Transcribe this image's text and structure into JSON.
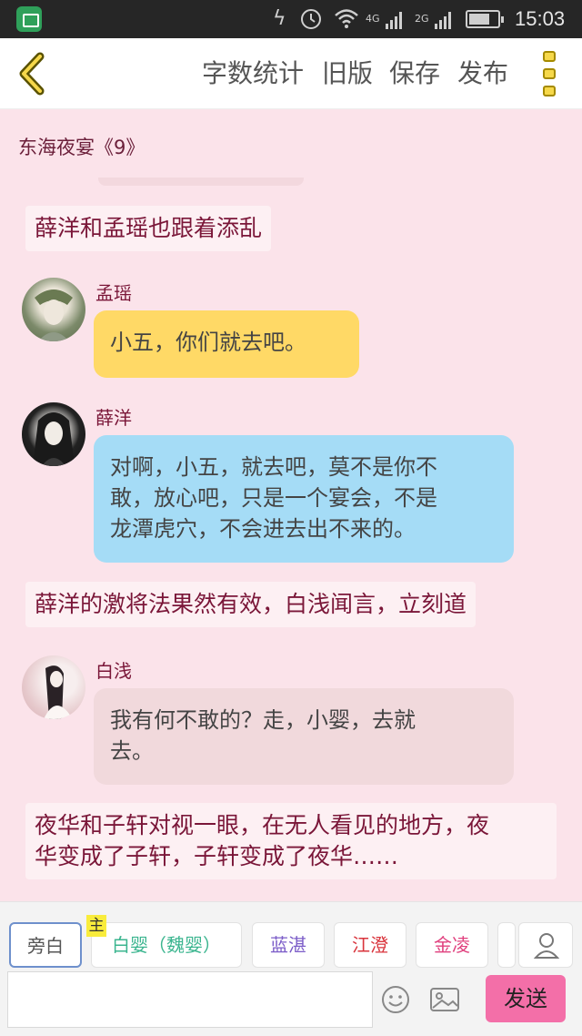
{
  "status_bar": {
    "network_1": "4G",
    "network_2": "2G",
    "time": "15:03"
  },
  "toolbar": {
    "word_count": "字数统计",
    "old_version": "旧版",
    "save": "保存",
    "publish": "发布"
  },
  "story": {
    "title": "东海夜宴《9》"
  },
  "messages": {
    "narration_1": "薛洋和孟瑶也跟着添乱",
    "m1_speaker": "孟瑶",
    "m1_text": "小五，你们就去吧。",
    "m2_speaker": "薛洋",
    "m2_line1": "对啊，小五，就去吧，莫不是你不",
    "m2_line2": "敢，放心吧，只是一个宴会，不是",
    "m2_line3": "龙潭虎穴，不会进去出不来的。",
    "narration_2": "薛洋的激将法果然有效，白浅闻言，立刻道",
    "m3_speaker": "白浅",
    "m3_line1": "我有何不敢的？走，小婴，去就",
    "m3_line2": "去。",
    "narration_3_line1": "夜华和子轩对视一眼，在无人看见的地方，夜",
    "narration_3_line2": "华变成了子轩，子轩变成了夜华……"
  },
  "character_chips": {
    "narrator": "旁白",
    "main_tag": "主",
    "char1": "白婴（魏婴）",
    "char2": "蓝湛",
    "char3": "江澄",
    "char4": "金凌"
  },
  "composer": {
    "placeholder": "",
    "send": "发送"
  },
  "colors": {
    "background": "#fbe3ea",
    "accent_send": "#f36fa8",
    "bubble_yellow": "#ffd966",
    "bubble_blue": "#a5dcf6",
    "bubble_pink": "#f1d9dc",
    "chip_char1": "#3bb58f",
    "chip_char2": "#7b5cc8",
    "chip_char3": "#d9343c",
    "chip_char4": "#e0407e"
  },
  "icons": [
    "image-app-icon",
    "flash-icon",
    "alarm-icon",
    "wifi-icon",
    "battery-icon",
    "back-chevron-icon",
    "more-menu-icon",
    "person-icon",
    "emoji-icon",
    "image-icon"
  ]
}
